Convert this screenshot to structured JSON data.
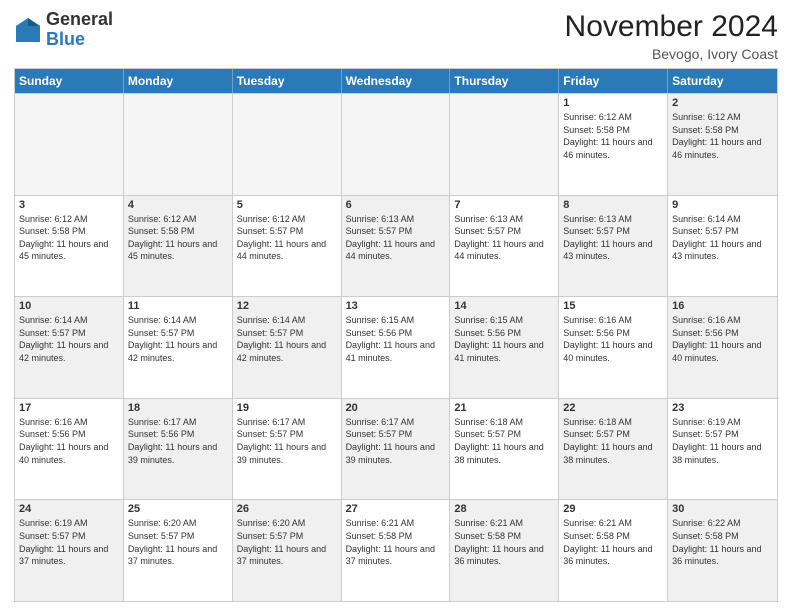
{
  "logo": {
    "general": "General",
    "blue": "Blue"
  },
  "title": "November 2024",
  "location": "Bevogo, Ivory Coast",
  "days": [
    "Sunday",
    "Monday",
    "Tuesday",
    "Wednesday",
    "Thursday",
    "Friday",
    "Saturday"
  ],
  "rows": [
    [
      {
        "day": "",
        "text": "",
        "empty": true
      },
      {
        "day": "",
        "text": "",
        "empty": true
      },
      {
        "day": "",
        "text": "",
        "empty": true
      },
      {
        "day": "",
        "text": "",
        "empty": true
      },
      {
        "day": "",
        "text": "",
        "empty": true
      },
      {
        "day": "1",
        "text": "Sunrise: 6:12 AM\nSunset: 5:58 PM\nDaylight: 11 hours and 46 minutes.",
        "empty": false
      },
      {
        "day": "2",
        "text": "Sunrise: 6:12 AM\nSunset: 5:58 PM\nDaylight: 11 hours and 46 minutes.",
        "empty": false,
        "shaded": true
      }
    ],
    [
      {
        "day": "3",
        "text": "Sunrise: 6:12 AM\nSunset: 5:58 PM\nDaylight: 11 hours and 45 minutes.",
        "empty": false
      },
      {
        "day": "4",
        "text": "Sunrise: 6:12 AM\nSunset: 5:58 PM\nDaylight: 11 hours and 45 minutes.",
        "empty": false,
        "shaded": true
      },
      {
        "day": "5",
        "text": "Sunrise: 6:12 AM\nSunset: 5:57 PM\nDaylight: 11 hours and 44 minutes.",
        "empty": false
      },
      {
        "day": "6",
        "text": "Sunrise: 6:13 AM\nSunset: 5:57 PM\nDaylight: 11 hours and 44 minutes.",
        "empty": false,
        "shaded": true
      },
      {
        "day": "7",
        "text": "Sunrise: 6:13 AM\nSunset: 5:57 PM\nDaylight: 11 hours and 44 minutes.",
        "empty": false
      },
      {
        "day": "8",
        "text": "Sunrise: 6:13 AM\nSunset: 5:57 PM\nDaylight: 11 hours and 43 minutes.",
        "empty": false,
        "shaded": true
      },
      {
        "day": "9",
        "text": "Sunrise: 6:14 AM\nSunset: 5:57 PM\nDaylight: 11 hours and 43 minutes.",
        "empty": false
      }
    ],
    [
      {
        "day": "10",
        "text": "Sunrise: 6:14 AM\nSunset: 5:57 PM\nDaylight: 11 hours and 42 minutes.",
        "empty": false,
        "shaded": true
      },
      {
        "day": "11",
        "text": "Sunrise: 6:14 AM\nSunset: 5:57 PM\nDaylight: 11 hours and 42 minutes.",
        "empty": false
      },
      {
        "day": "12",
        "text": "Sunrise: 6:14 AM\nSunset: 5:57 PM\nDaylight: 11 hours and 42 minutes.",
        "empty": false,
        "shaded": true
      },
      {
        "day": "13",
        "text": "Sunrise: 6:15 AM\nSunset: 5:56 PM\nDaylight: 11 hours and 41 minutes.",
        "empty": false
      },
      {
        "day": "14",
        "text": "Sunrise: 6:15 AM\nSunset: 5:56 PM\nDaylight: 11 hours and 41 minutes.",
        "empty": false,
        "shaded": true
      },
      {
        "day": "15",
        "text": "Sunrise: 6:16 AM\nSunset: 5:56 PM\nDaylight: 11 hours and 40 minutes.",
        "empty": false
      },
      {
        "day": "16",
        "text": "Sunrise: 6:16 AM\nSunset: 5:56 PM\nDaylight: 11 hours and 40 minutes.",
        "empty": false,
        "shaded": true
      }
    ],
    [
      {
        "day": "17",
        "text": "Sunrise: 6:16 AM\nSunset: 5:56 PM\nDaylight: 11 hours and 40 minutes.",
        "empty": false
      },
      {
        "day": "18",
        "text": "Sunrise: 6:17 AM\nSunset: 5:56 PM\nDaylight: 11 hours and 39 minutes.",
        "empty": false,
        "shaded": true
      },
      {
        "day": "19",
        "text": "Sunrise: 6:17 AM\nSunset: 5:57 PM\nDaylight: 11 hours and 39 minutes.",
        "empty": false
      },
      {
        "day": "20",
        "text": "Sunrise: 6:17 AM\nSunset: 5:57 PM\nDaylight: 11 hours and 39 minutes.",
        "empty": false,
        "shaded": true
      },
      {
        "day": "21",
        "text": "Sunrise: 6:18 AM\nSunset: 5:57 PM\nDaylight: 11 hours and 38 minutes.",
        "empty": false
      },
      {
        "day": "22",
        "text": "Sunrise: 6:18 AM\nSunset: 5:57 PM\nDaylight: 11 hours and 38 minutes.",
        "empty": false,
        "shaded": true
      },
      {
        "day": "23",
        "text": "Sunrise: 6:19 AM\nSunset: 5:57 PM\nDaylight: 11 hours and 38 minutes.",
        "empty": false
      }
    ],
    [
      {
        "day": "24",
        "text": "Sunrise: 6:19 AM\nSunset: 5:57 PM\nDaylight: 11 hours and 37 minutes.",
        "empty": false,
        "shaded": true
      },
      {
        "day": "25",
        "text": "Sunrise: 6:20 AM\nSunset: 5:57 PM\nDaylight: 11 hours and 37 minutes.",
        "empty": false
      },
      {
        "day": "26",
        "text": "Sunrise: 6:20 AM\nSunset: 5:57 PM\nDaylight: 11 hours and 37 minutes.",
        "empty": false,
        "shaded": true
      },
      {
        "day": "27",
        "text": "Sunrise: 6:21 AM\nSunset: 5:58 PM\nDaylight: 11 hours and 37 minutes.",
        "empty": false
      },
      {
        "day": "28",
        "text": "Sunrise: 6:21 AM\nSunset: 5:58 PM\nDaylight: 11 hours and 36 minutes.",
        "empty": false,
        "shaded": true
      },
      {
        "day": "29",
        "text": "Sunrise: 6:21 AM\nSunset: 5:58 PM\nDaylight: 11 hours and 36 minutes.",
        "empty": false
      },
      {
        "day": "30",
        "text": "Sunrise: 6:22 AM\nSunset: 5:58 PM\nDaylight: 11 hours and 36 minutes.",
        "empty": false,
        "shaded": true
      }
    ]
  ]
}
